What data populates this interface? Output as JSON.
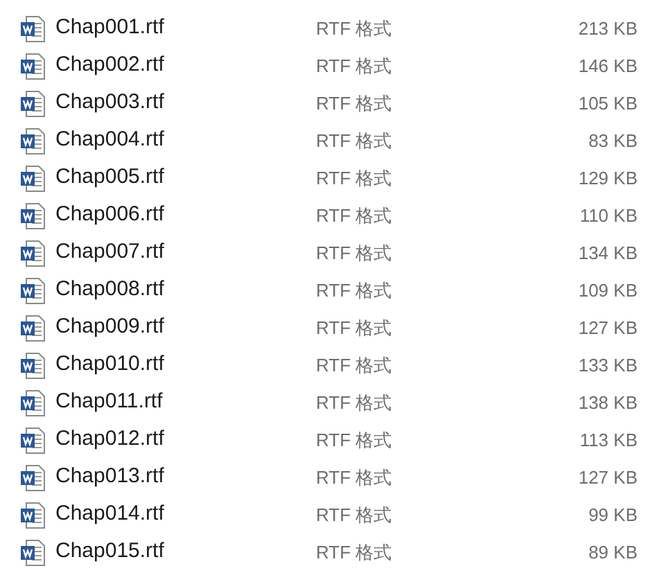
{
  "files": [
    {
      "name": "Chap001.rtf",
      "type": "RTF 格式",
      "size": "213 KB"
    },
    {
      "name": "Chap002.rtf",
      "type": "RTF 格式",
      "size": "146 KB"
    },
    {
      "name": "Chap003.rtf",
      "type": "RTF 格式",
      "size": "105 KB"
    },
    {
      "name": "Chap004.rtf",
      "type": "RTF 格式",
      "size": "83 KB"
    },
    {
      "name": "Chap005.rtf",
      "type": "RTF 格式",
      "size": "129 KB"
    },
    {
      "name": "Chap006.rtf",
      "type": "RTF 格式",
      "size": "110 KB"
    },
    {
      "name": "Chap007.rtf",
      "type": "RTF 格式",
      "size": "134 KB"
    },
    {
      "name": "Chap008.rtf",
      "type": "RTF 格式",
      "size": "109 KB"
    },
    {
      "name": "Chap009.rtf",
      "type": "RTF 格式",
      "size": "127 KB"
    },
    {
      "name": "Chap010.rtf",
      "type": "RTF 格式",
      "size": "133 KB"
    },
    {
      "name": "Chap011.rtf",
      "type": "RTF 格式",
      "size": "138 KB"
    },
    {
      "name": "Chap012.rtf",
      "type": "RTF 格式",
      "size": "113 KB"
    },
    {
      "name": "Chap013.rtf",
      "type": "RTF 格式",
      "size": "127 KB"
    },
    {
      "name": "Chap014.rtf",
      "type": "RTF 格式",
      "size": "99 KB"
    },
    {
      "name": "Chap015.rtf",
      "type": "RTF 格式",
      "size": "89 KB"
    }
  ]
}
